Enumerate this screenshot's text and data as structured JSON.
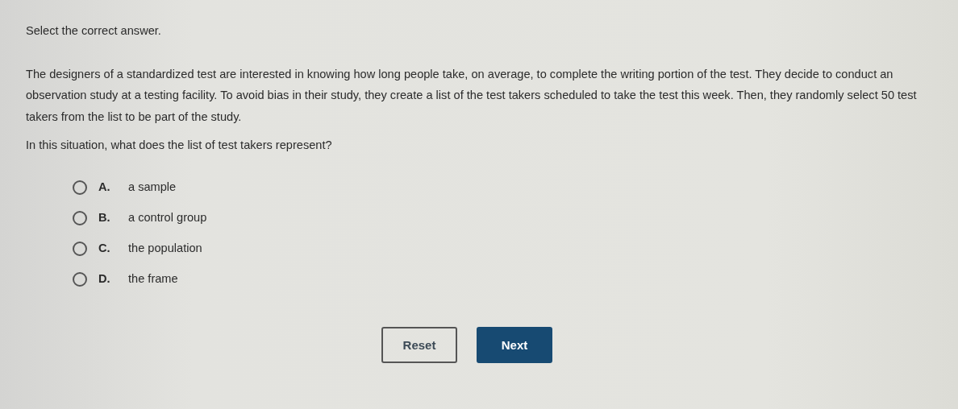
{
  "instruction": "Select the correct answer.",
  "passage": "The designers of a standardized test are interested in knowing how long people take, on average, to complete the writing portion of the test. They decide to conduct an observation study at a testing facility. To avoid bias in their study, they create a list of the test takers scheduled to take the test this week. Then, they randomly select 50 test takers from the list to be part of the study.",
  "question": "In this situation, what does the list of test takers represent?",
  "options": [
    {
      "letter": "A.",
      "text": "a sample",
      "selected": false
    },
    {
      "letter": "B.",
      "text": "a control group",
      "selected": false
    },
    {
      "letter": "C.",
      "text": "the population",
      "selected": false
    },
    {
      "letter": "D.",
      "text": "the frame",
      "selected": false
    }
  ],
  "buttons": [
    {
      "label": "Reset",
      "kind": "secondary"
    },
    {
      "label": "Next",
      "kind": "primary"
    }
  ]
}
